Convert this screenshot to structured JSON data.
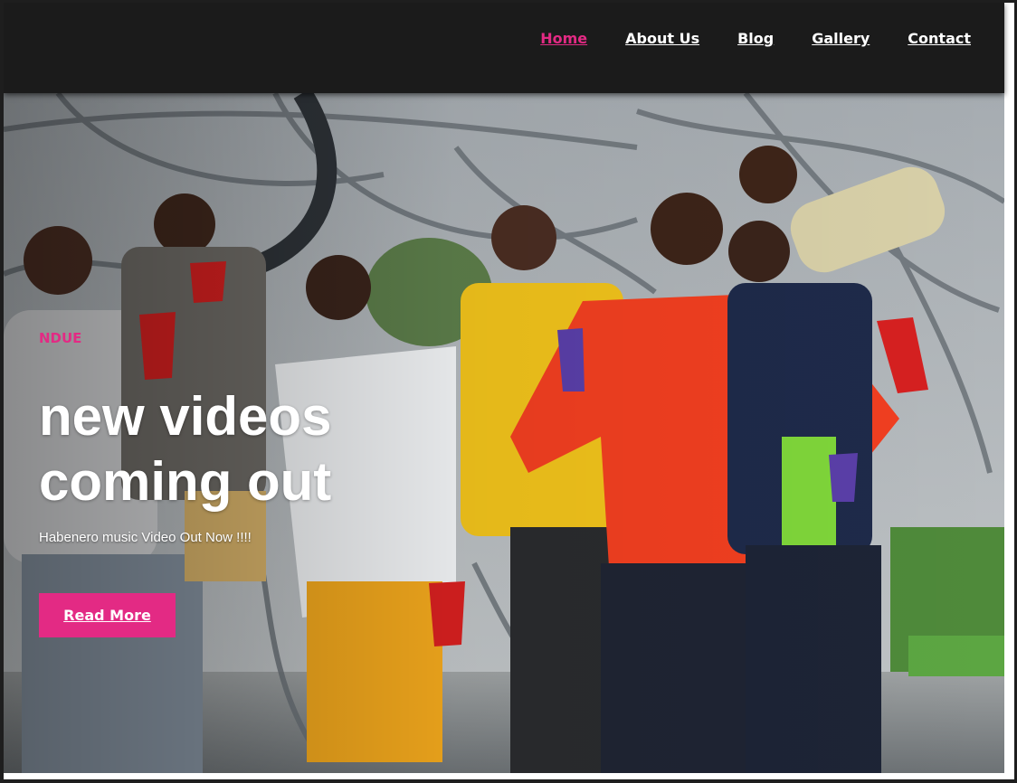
{
  "nav": {
    "items": [
      {
        "label": "Home",
        "active": true
      },
      {
        "label": "About Us",
        "active": false
      },
      {
        "label": "Blog",
        "active": false
      },
      {
        "label": "Gallery",
        "active": false
      },
      {
        "label": "Contact",
        "active": false
      }
    ]
  },
  "hero": {
    "eyebrow": "NDUE",
    "headline": "new videos coming out",
    "subtitle": "Habenero music Video Out Now !!!!",
    "button_label": "Read More",
    "image": "group-photo"
  },
  "colors": {
    "accent": "#e32a84",
    "navbar": "#1b1b1b",
    "text_light": "#ffffff"
  }
}
